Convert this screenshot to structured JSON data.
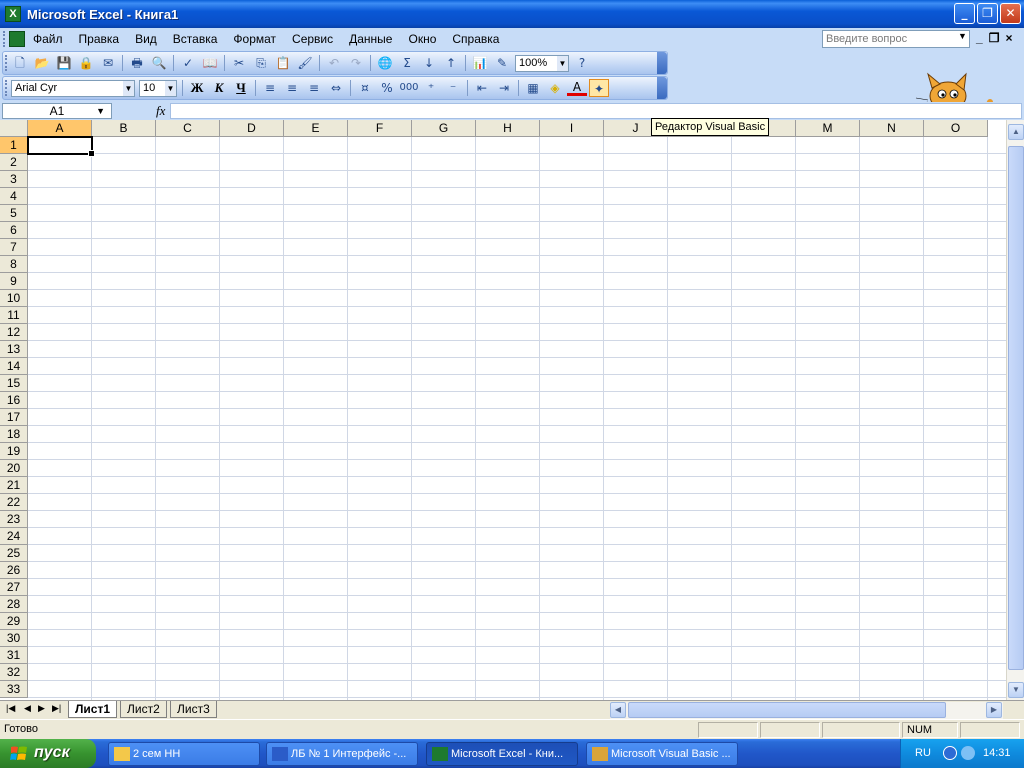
{
  "window": {
    "title": "Microsoft Excel - Книга1"
  },
  "menu": {
    "items": [
      "Файл",
      "Правка",
      "Вид",
      "Вставка",
      "Формат",
      "Сервис",
      "Данные",
      "Окно",
      "Справка"
    ],
    "question_placeholder": "Введите вопрос"
  },
  "toolbar_standard": {
    "zoom": "100%"
  },
  "toolbar_formatting": {
    "font": "Arial Cyr",
    "size": "10",
    "bold": "Ж",
    "italic": "К",
    "underline": "Ч",
    "percent": "%",
    "thousands": "000"
  },
  "formula_bar": {
    "name_box": "A1",
    "fx": "fx",
    "value": ""
  },
  "tooltip": "Редактор Visual Basic",
  "columns": [
    "A",
    "B",
    "C",
    "D",
    "E",
    "F",
    "G",
    "H",
    "I",
    "J",
    "K",
    "L",
    "M",
    "N",
    "O"
  ],
  "rows": [
    "1",
    "2",
    "3",
    "4",
    "5",
    "6",
    "7",
    "8",
    "9",
    "10",
    "11",
    "12",
    "13",
    "14",
    "15",
    "16",
    "17",
    "18",
    "19",
    "20",
    "21",
    "22",
    "23",
    "24",
    "25",
    "26",
    "27",
    "28",
    "29",
    "30",
    "31",
    "32",
    "33"
  ],
  "selection": {
    "column": "A",
    "row": "1"
  },
  "sheets": [
    "Лист1",
    "Лист2",
    "Лист3"
  ],
  "active_sheet": "Лист1",
  "status": {
    "ready": "Готово",
    "num": "NUM"
  },
  "taskbar": {
    "start": "пуск",
    "tasks": [
      "2 сем НН",
      "ЛБ № 1 Интерфейс -...",
      "Microsoft Excel - Кни...",
      "Microsoft Visual Basic ..."
    ],
    "active_task": 2,
    "lang": "RU",
    "clock": "14:31"
  },
  "colors": {
    "title_blue": "#0a58d6",
    "menu_bg": "#c7dcf7",
    "header_bg": "#ece9d8",
    "selected_header": "#ffc66b",
    "gridline": "#d0d7e5",
    "start_green": "#37932f"
  }
}
